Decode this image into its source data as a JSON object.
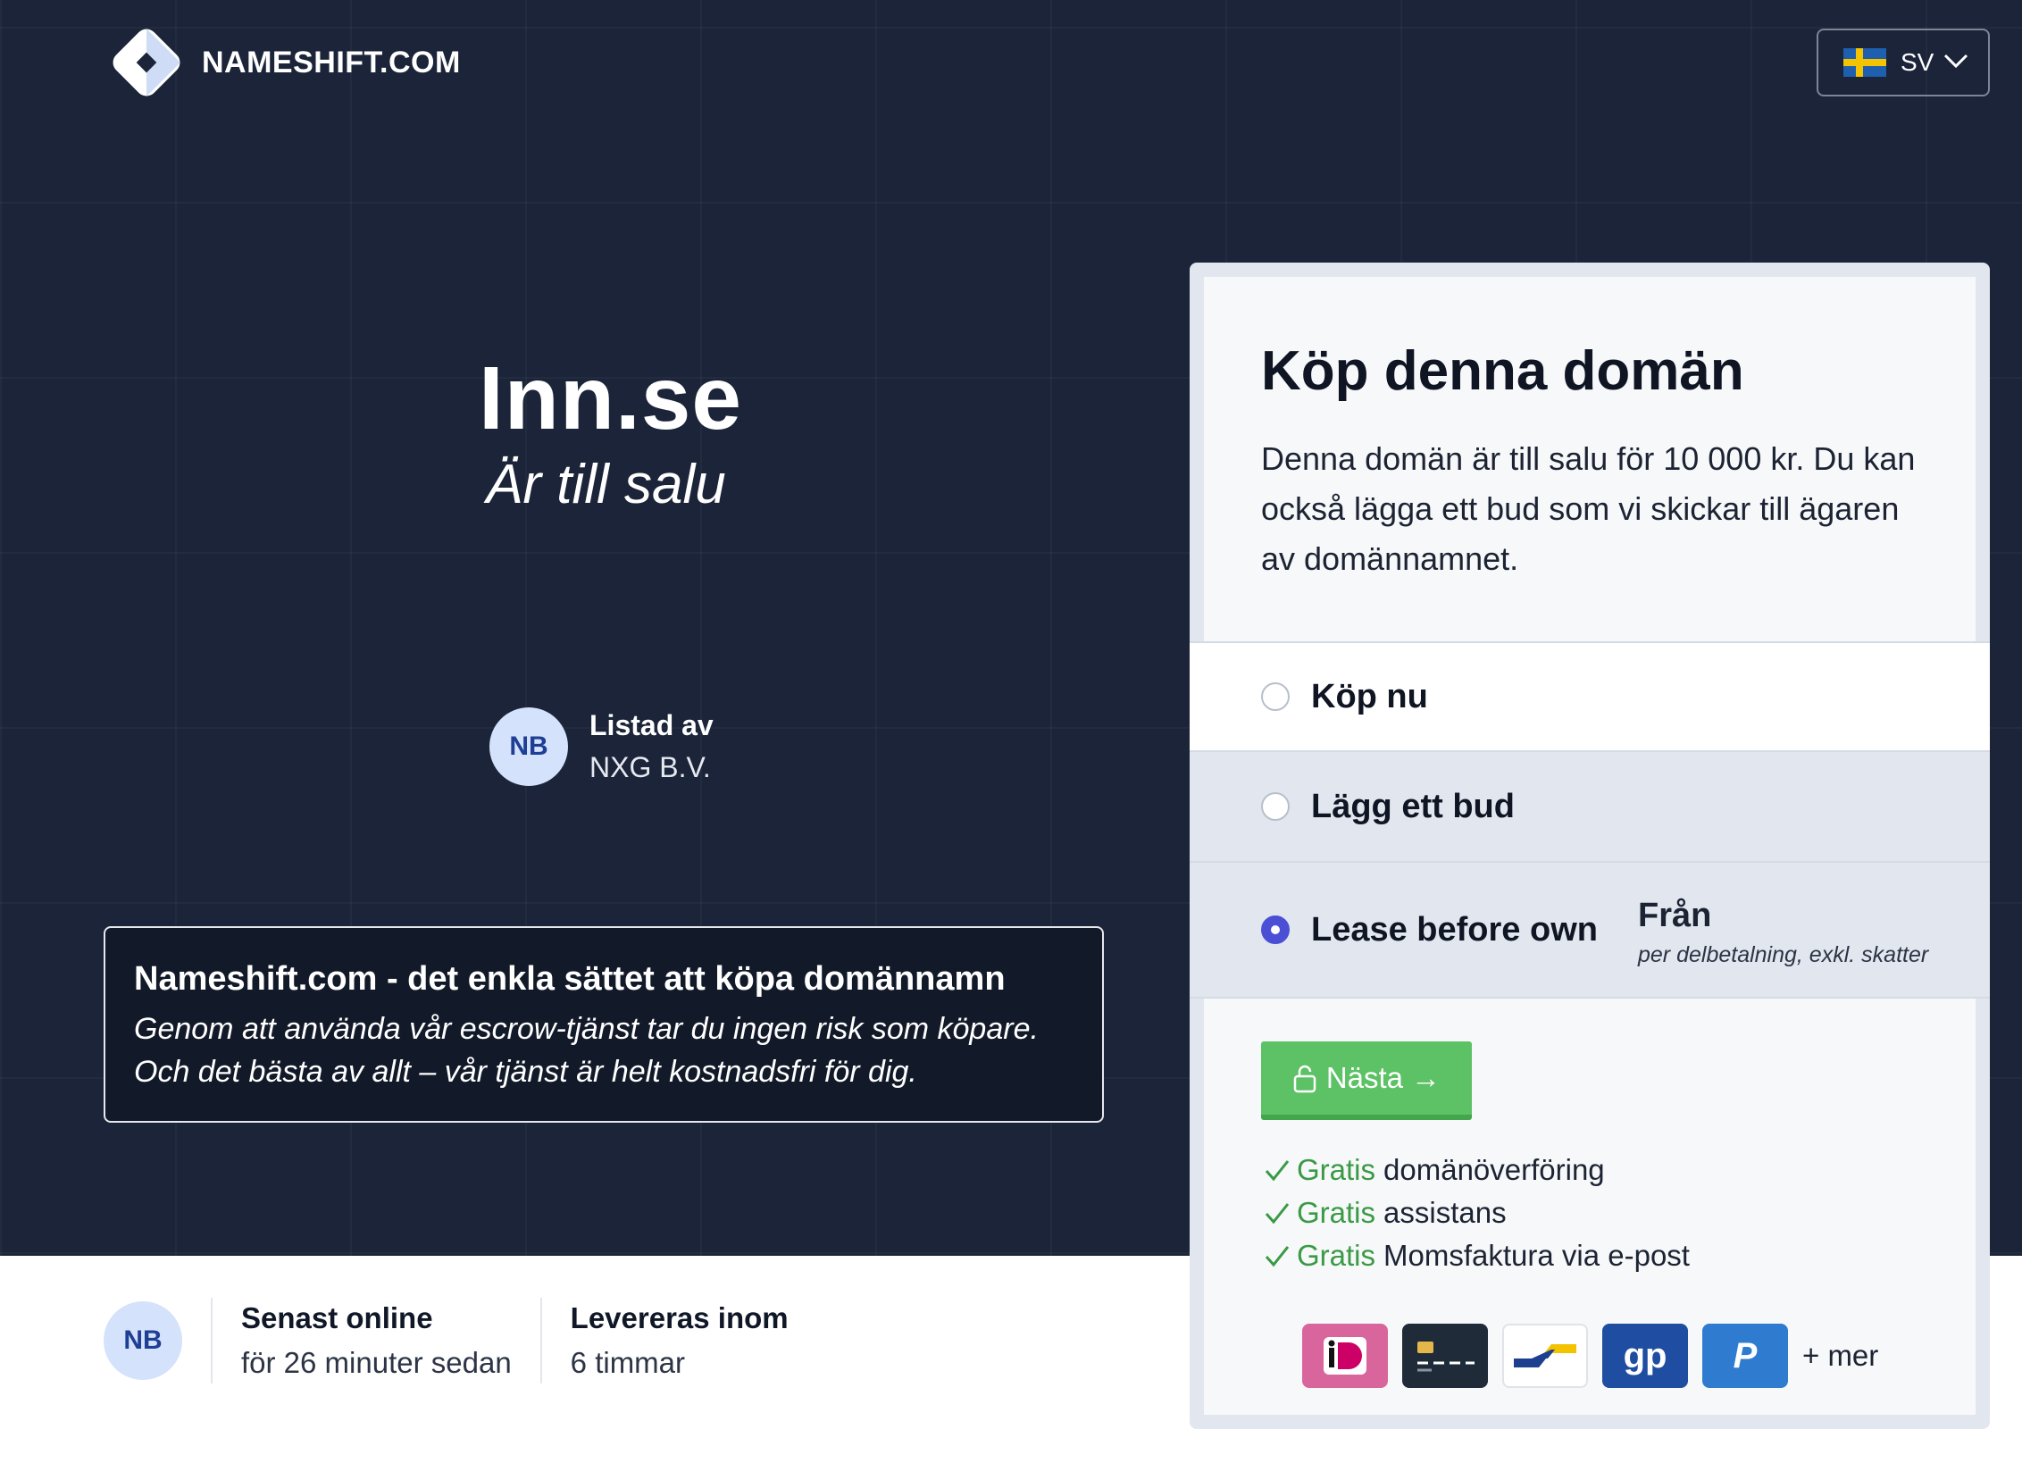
{
  "header": {
    "logo_text": "NAMESHIFT.COM",
    "language_code": "SV",
    "language_flag": "swedish-flag"
  },
  "hero": {
    "domain_name": "Inn.se",
    "subtitle": "Är till salu",
    "listed_by_label": "Listad av",
    "listed_by_value": "NXG B.V.",
    "avatar_initials": "NB"
  },
  "info_box": {
    "title": "Nameshift.com - det enkla sättet att köpa domännamn",
    "description": "Genom att använda vår escrow-tjänst tar du ingen risk som köpare. Och det bästa av allt – vår tjänst är helt kostnadsfri för dig."
  },
  "stats": {
    "avatar_initials": "NB",
    "last_online_label": "Senast online",
    "last_online_value": "för 26 minuter sedan",
    "delivery_label": "Levereras inom",
    "delivery_value": "6 timmar"
  },
  "purchase_card": {
    "title": "Köp denna domän",
    "description": "Denna domän är till salu för 10 000 kr. Du kan också lägga ett bud som vi skickar till ägaren av domännamnet.",
    "options": [
      {
        "label": "Köp nu",
        "selected": false
      },
      {
        "label": "Lägg ett bud",
        "selected": false
      },
      {
        "label": "Lease before own",
        "selected": true,
        "from_label": "Från",
        "from_note": "per delbetalning, exkl. skatter"
      }
    ],
    "next_button": "Nästa →",
    "features": [
      {
        "highlight": "Gratis",
        "text": "domänöverföring"
      },
      {
        "highlight": "Gratis",
        "text": "assistans"
      },
      {
        "highlight": "Gratis",
        "text": "Momsfaktura via e-post"
      }
    ],
    "payment_methods": [
      "ideal-icon",
      "credit-card-icon",
      "bancontact-icon",
      "gp-icon",
      "paypal-icon"
    ],
    "payment_gp_text": "gp",
    "payment_paypal_text": "P",
    "more_label": "+ mer"
  },
  "colors": {
    "hero_bg": "#1b2438",
    "accent_green": "#5cc265",
    "radio_selected": "#4b4fd6",
    "avatar_bg": "#d4e2fb"
  }
}
